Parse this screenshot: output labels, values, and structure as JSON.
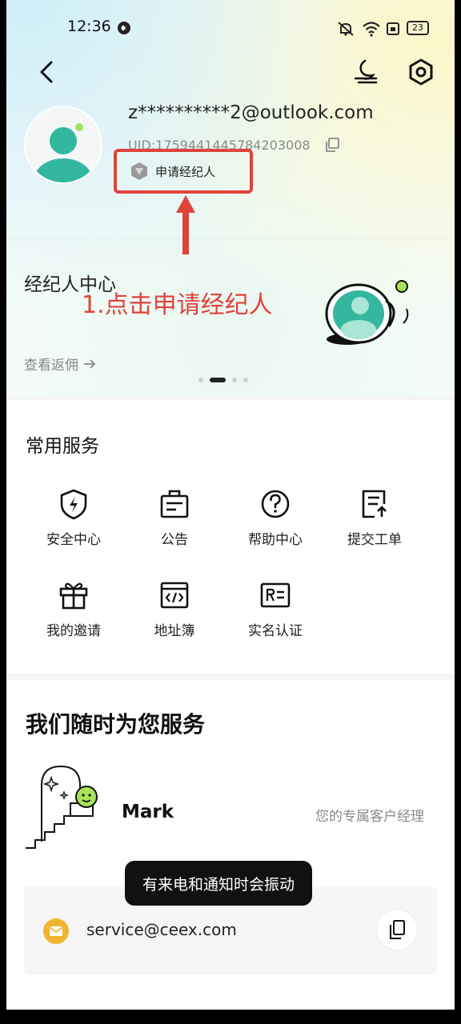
{
  "status_bar": {
    "time": "12:36",
    "battery": "23"
  },
  "header": {
    "back_icon": "chevron-left-icon",
    "theme_icon": "moon-icon",
    "settings_icon": "hexagon-gear-icon"
  },
  "profile": {
    "email": "z**********2@outlook.com",
    "uid": "UID:1759441445784203008",
    "apply_broker_label": "申请经纪人"
  },
  "annotation": {
    "step_text": "1.点击申请经纪人",
    "color": "#e0433c"
  },
  "broker_card": {
    "title": "经纪人中心",
    "rebate_link": "查看返佣",
    "carousel_pages": 4,
    "carousel_active": 2
  },
  "common_services": {
    "title": "常用服务",
    "items": [
      {
        "label": "安全中心",
        "icon": "shield-icon"
      },
      {
        "label": "公告",
        "icon": "announcement-icon"
      },
      {
        "label": "帮助中心",
        "icon": "help-icon"
      },
      {
        "label": "提交工单",
        "icon": "ticket-icon"
      },
      {
        "label": "我的邀请",
        "icon": "gift-icon"
      },
      {
        "label": "地址簿",
        "icon": "code-book-icon"
      },
      {
        "label": "实名认证",
        "icon": "id-card-icon"
      }
    ]
  },
  "service_section": {
    "title": "我们随时为您服务",
    "agent_name": "Mark",
    "agent_role": "您的专属客户经理",
    "contact_email": "service@ceex.com"
  },
  "toast": {
    "text": "有来电和通知时会振动"
  }
}
